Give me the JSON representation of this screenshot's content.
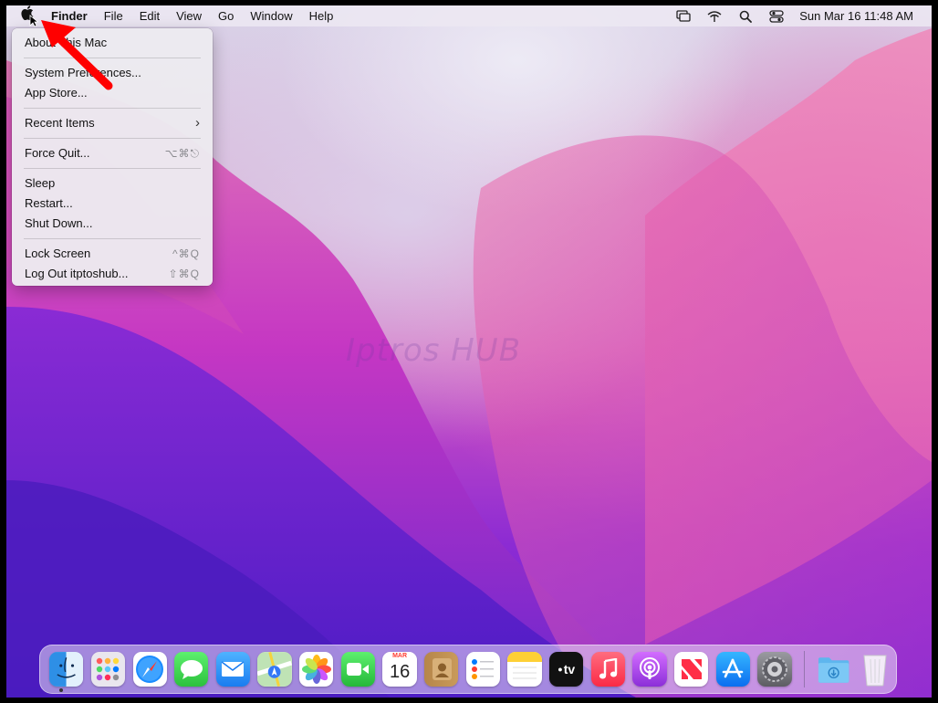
{
  "menubar": {
    "apple_icon": "apple-logo-icon",
    "app_name": "Finder",
    "menus": [
      "File",
      "Edit",
      "View",
      "Go",
      "Window",
      "Help"
    ],
    "status_icons": [
      "screen-mirroring-icon",
      "wifi-icon",
      "spotlight-search-icon",
      "control-center-icon"
    ],
    "clock": "Sun Mar 16  11:48 AM"
  },
  "apple_menu": {
    "groups": [
      [
        {
          "label": "About This Mac",
          "shortcut": ""
        }
      ],
      [
        {
          "label": "System Preferences...",
          "shortcut": ""
        },
        {
          "label": "App Store...",
          "shortcut": ""
        }
      ],
      [
        {
          "label": "Recent Items",
          "shortcut": "›"
        }
      ],
      [
        {
          "label": "Force Quit...",
          "shortcut": "⌥⌘⎋"
        }
      ],
      [
        {
          "label": "Sleep",
          "shortcut": ""
        },
        {
          "label": "Restart...",
          "shortcut": ""
        },
        {
          "label": "Shut Down...",
          "shortcut": ""
        }
      ],
      [
        {
          "label": "Lock Screen",
          "shortcut": "^⌘Q"
        },
        {
          "label": "Log Out itptoshub...",
          "shortcut": "⇧⌘Q"
        }
      ]
    ]
  },
  "watermark": "Iptros HUB",
  "annotation": {
    "arrow_color": "#ff0000"
  },
  "dock": {
    "apps": [
      {
        "name": "Finder",
        "icon": "finder-icon"
      },
      {
        "name": "Launchpad",
        "icon": "launchpad-icon"
      },
      {
        "name": "Safari",
        "icon": "safari-icon"
      },
      {
        "name": "Messages",
        "icon": "messages-icon"
      },
      {
        "name": "Mail",
        "icon": "mail-icon"
      },
      {
        "name": "Maps",
        "icon": "maps-icon"
      },
      {
        "name": "Photos",
        "icon": "photos-icon"
      },
      {
        "name": "FaceTime",
        "icon": "facetime-icon"
      },
      {
        "name": "Calendar",
        "icon": "calendar-icon"
      },
      {
        "name": "Contacts",
        "icon": "contacts-icon"
      },
      {
        "name": "Reminders",
        "icon": "reminders-icon"
      },
      {
        "name": "Notes",
        "icon": "notes-icon"
      },
      {
        "name": "TV",
        "icon": "apple-tv-icon"
      },
      {
        "name": "Music",
        "icon": "music-icon"
      },
      {
        "name": "Podcasts",
        "icon": "podcasts-icon"
      },
      {
        "name": "News",
        "icon": "news-icon"
      },
      {
        "name": "App Store",
        "icon": "app-store-icon"
      },
      {
        "name": "System Preferences",
        "icon": "system-preferences-icon"
      }
    ],
    "calendar": {
      "month": "MAR",
      "day": "16"
    },
    "tv_label": "tv",
    "trailing": [
      {
        "name": "Downloads",
        "icon": "downloads-folder-icon"
      },
      {
        "name": "Trash",
        "icon": "trash-icon"
      }
    ]
  }
}
